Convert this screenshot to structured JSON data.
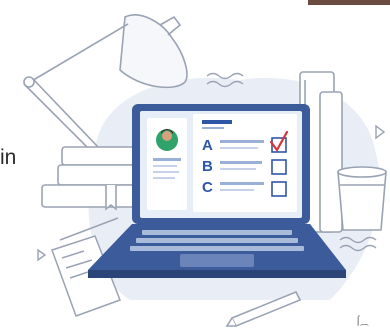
{
  "fragment_text": "in",
  "corner_note": "⌠⁔",
  "quiz": {
    "options": [
      {
        "letter": "A",
        "checked": true
      },
      {
        "letter": "B",
        "checked": false
      },
      {
        "letter": "C",
        "checked": false
      }
    ]
  },
  "colors": {
    "outline": "#9aa3b3",
    "laptop_blue": "#3b5b9a",
    "laptop_dark": "#2d4478",
    "screen_bg": "#e8eef7",
    "answer_blue": "#2f56a6",
    "check_red": "#d6333a",
    "backdrop": "#e9eef6",
    "avatar_shirt": "#2fa36b",
    "avatar_skin": "#d9a07e",
    "hair": "#3a2a22"
  },
  "icons": [
    "desk-lamp-icon",
    "book-stack-icon",
    "coffee-cup-icon",
    "pen-icon",
    "letter-icon",
    "checkmark-icon",
    "avatar-icon",
    "play-arrow-icon"
  ]
}
